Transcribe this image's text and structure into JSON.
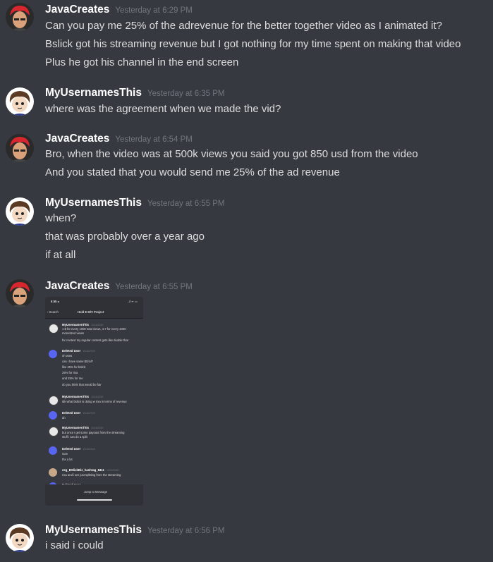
{
  "messages": [
    {
      "author": "JavaCreates",
      "timestamp": "Yesterday at 6:29 PM",
      "lines": [
        "Can you pay me 25% of the adrevenue for the better together video as I animated it?",
        "Bslick got his streaming revenue but I got nothing for my time spent on making that video",
        "Plus he got his channel in the end screen"
      ]
    },
    {
      "author": "MyUsernamesThis",
      "timestamp": "Yesterday at 6:35 PM",
      "lines": [
        "where was the agreement when we made the vid?"
      ]
    },
    {
      "author": "JavaCreates",
      "timestamp": "Yesterday at 6:54 PM",
      "lines": [
        "Bro, when the video was at 500k views you said you got 850 usd from the video",
        "And you stated that you would send me 25% of the ad revenue"
      ]
    },
    {
      "author": "MyUsernamesThis",
      "timestamp": "Yesterday at 6:55 PM",
      "lines": [
        "when?",
        "that was probably over a year ago",
        "if at all"
      ]
    },
    {
      "author": "JavaCreates",
      "timestamp": "Yesterday at 6:55 PM",
      "lines": []
    },
    {
      "author": "MyUsernamesThis",
      "timestamp": "Yesterday at 6:56 PM",
      "lines": [
        "i said i could"
      ]
    }
  ],
  "attachment": {
    "status_time": "6:55 ◂",
    "status_icons": "..ıl ᯤ ▭",
    "back_label": "‹ Search",
    "title": "Hold E M/V Project",
    "jump_label": "Jump to Message",
    "messages": [
      {
        "author": "MyUsernamesThis",
        "date": "10/16/2020",
        "lines": [
          "1 $ for every 1000 total views, 4.7 for every 1000",
          "monetized views",
          "for context my regular content gets like double that"
        ]
      },
      {
        "author": "Deleted User",
        "date": "10/16/2020",
        "lines": [
          "oh wow",
          "can i have same $$ lol?",
          "like 25% for bslick",
          "25% for rixa",
          "and 25% for me",
          "do you think that would be fair"
        ]
      },
      {
        "author": "MyUsernamesThis",
        "date": "10/16/2020",
        "lines": [
          "idk what bslick is doing w rixa in terms of revenue"
        ]
      },
      {
        "author": "Deleted User",
        "date": "10/16/2020",
        "lines": [
          "ah"
        ]
      },
      {
        "author": "MyUsernamesThis",
        "date": "10/16/2020",
        "lines": [
          "but once i get some payouts from the streaming",
          "stuff i can do a split"
        ]
      },
      {
        "author": "Deleted User",
        "date": "10/16/2020",
        "lines": [
          "sure",
          "thx a lot"
        ]
      },
      {
        "author": "eeg_BSlickBiz_hashtag_8411",
        "date": "10/16/2020",
        "lines": [
          "rixa and i are just splitting from the streaming"
        ]
      },
      {
        "author": "Deleted User",
        "date": "",
        "lines": []
      }
    ]
  }
}
